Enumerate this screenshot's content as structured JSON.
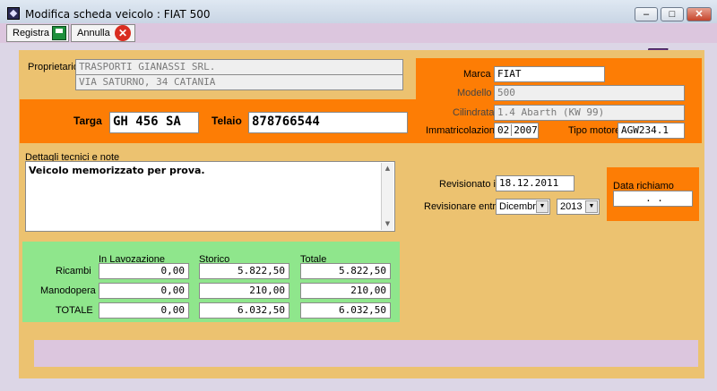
{
  "window": {
    "title": "Modifica scheda veicolo : FIAT 500",
    "minimize": "‒",
    "maximize": "□",
    "close": "✕"
  },
  "toolbar": {
    "save_label": "Registra",
    "cancel_label": "Annulla",
    "cancel_glyph": "✕"
  },
  "owner": {
    "label": "Proprietario",
    "name": "TRASPORTI GIANASSI SRL.",
    "address": "VIA SATURNO, 34 CATANIA"
  },
  "vehicle": {
    "marca_label": "Marca",
    "marca": "FIAT",
    "modello_label": "Modello",
    "modello": "500",
    "cilindrata_label": "Cilindrata",
    "cilindrata": "1.4 Abarth (KW 99)",
    "immatricolazione_label": "Immatricolazione",
    "immatricolazione_month": "02",
    "immatricolazione_year": "2007",
    "tipo_motore_label": "Tipo motore",
    "tipo_motore": "AGW234.1",
    "targa_label": "Targa",
    "targa": "GH 456 SA",
    "telaio_label": "Telaio",
    "telaio": "878766544"
  },
  "notes": {
    "label": "Dettagli tecnici e note",
    "value": "Veicolo memorizzato per prova."
  },
  "revision": {
    "revisionato_label": "Revisionato il",
    "revisionato": "18.12.2011",
    "entro_label": "Revisionare entro",
    "entro_month": "Dicembre",
    "entro_year": "2013",
    "richiamo_label": "Data richiamo",
    "richiamo": ".   ."
  },
  "costs": {
    "columns": [
      "In Lavozazione",
      "Storico",
      "Totale"
    ],
    "rows": [
      {
        "label": "Ricambi",
        "values": [
          "0,00",
          "5.822,50",
          "5.822,50"
        ]
      },
      {
        "label": "Manodopera",
        "values": [
          "0,00",
          "210,00",
          "210,00"
        ]
      },
      {
        "label": "TOTALE",
        "values": [
          "0,00",
          "6.032,50",
          "6.032,50"
        ]
      }
    ]
  },
  "colors": {
    "panel": "#ecc270",
    "orange": "#fd7d05",
    "green": "#8fe68c",
    "lilac": "#dcc6de"
  }
}
